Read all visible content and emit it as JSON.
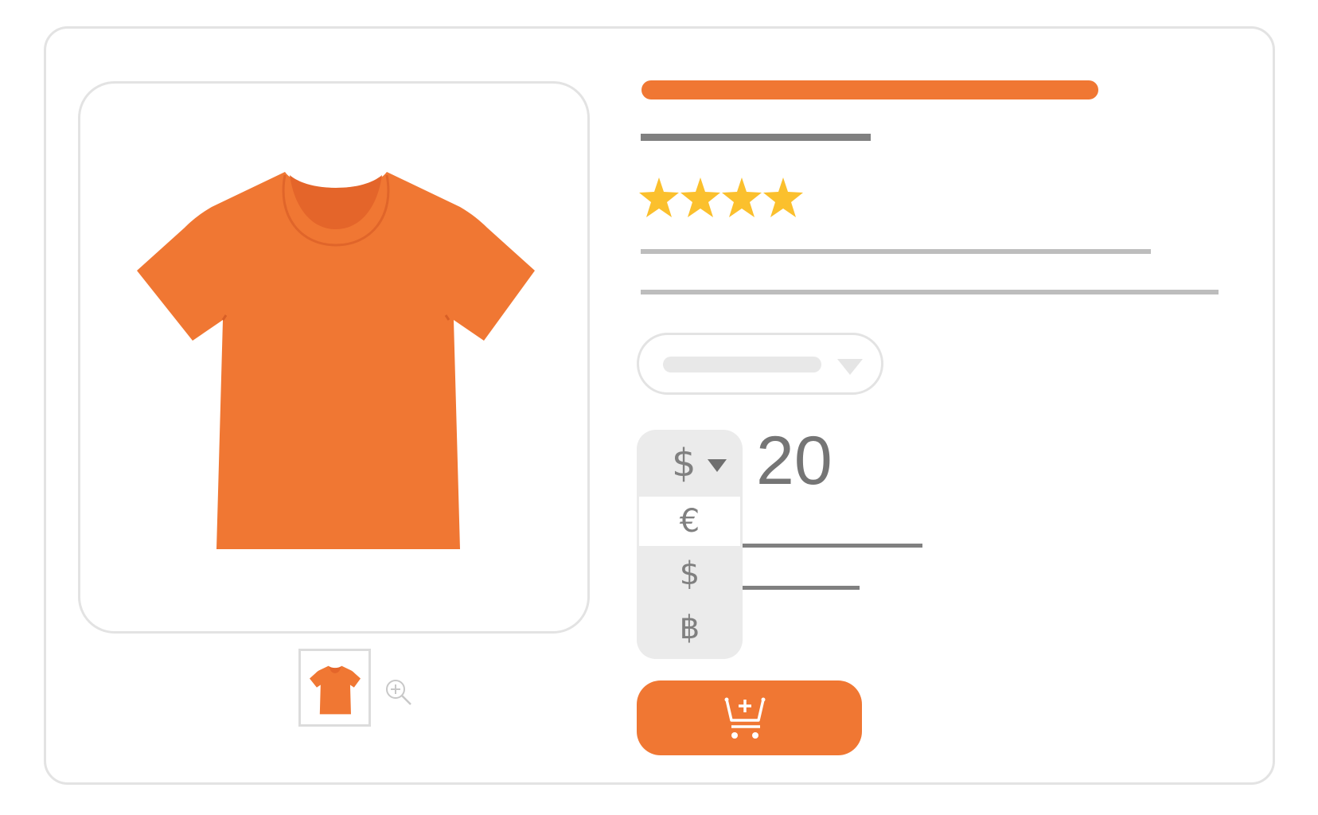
{
  "product": {
    "image_icon": "tshirt-icon",
    "color": "#f07733",
    "rating_stars": 4
  },
  "thumbnail": {
    "icon": "tshirt-icon"
  },
  "zoom": {
    "icon": "zoom-in-icon"
  },
  "currency_selector": {
    "selected": "$",
    "options": [
      "€",
      "$",
      "฿"
    ]
  },
  "price": {
    "value": "20"
  },
  "cart_button": {
    "icon": "add-to-cart-icon",
    "color": "#f07733"
  },
  "colors": {
    "accent": "#f07733",
    "star": "#fbc02d",
    "border": "#e3e3e3",
    "text_gray": "#808080"
  }
}
